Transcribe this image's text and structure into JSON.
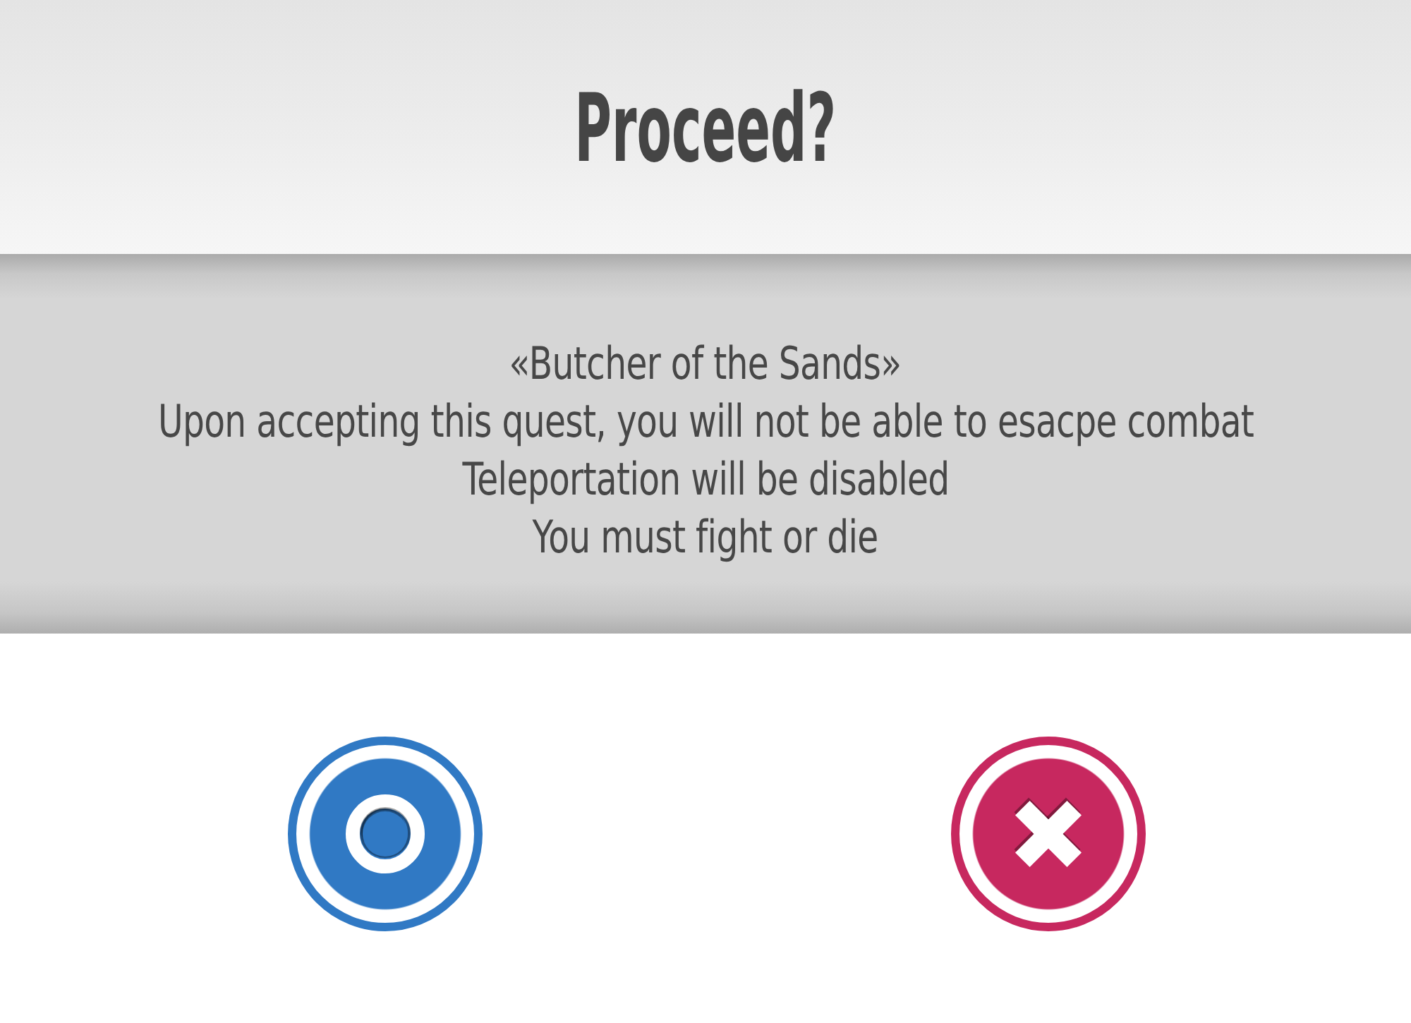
{
  "header": {
    "title": "Proceed?"
  },
  "message": {
    "lines": [
      "«Butcher of the Sands»",
      "Upon accepting this quest, you will not be able to esacpe combat",
      "Teleportation will be disabled",
      "You must fight or die"
    ]
  },
  "buttons": [
    {
      "kind": "confirm",
      "color": "#3079c4"
    },
    {
      "kind": "cancel",
      "color": "#c7285f"
    }
  ]
}
